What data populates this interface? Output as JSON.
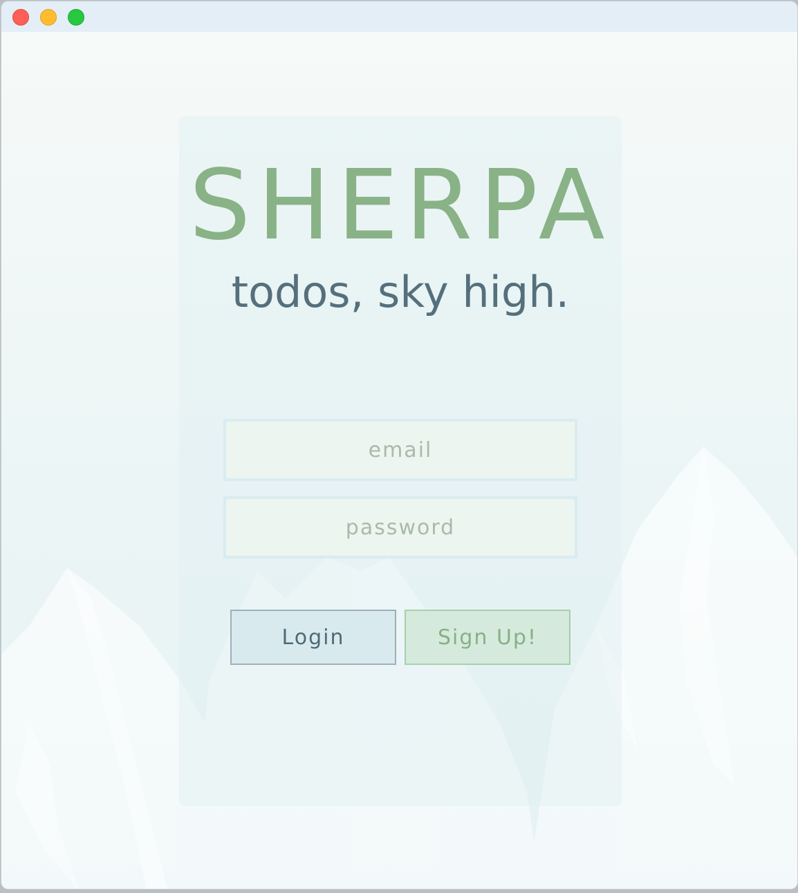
{
  "window": {
    "traffic_lights": [
      "close",
      "minimize",
      "maximize"
    ]
  },
  "brand": {
    "logo": "SHERPA",
    "tagline": "todos, sky high."
  },
  "form": {
    "email_placeholder": "email",
    "email_value": "",
    "password_placeholder": "password",
    "password_value": "",
    "login_label": "Login",
    "signup_label": "Sign Up!"
  },
  "colors": {
    "logo": "#89b286",
    "tagline": "#55707c",
    "login_border": "#9db0b8",
    "signup_border": "#a8cfa9",
    "close": "#fe5f57",
    "minimize": "#febc2e",
    "maximize": "#28c840"
  }
}
